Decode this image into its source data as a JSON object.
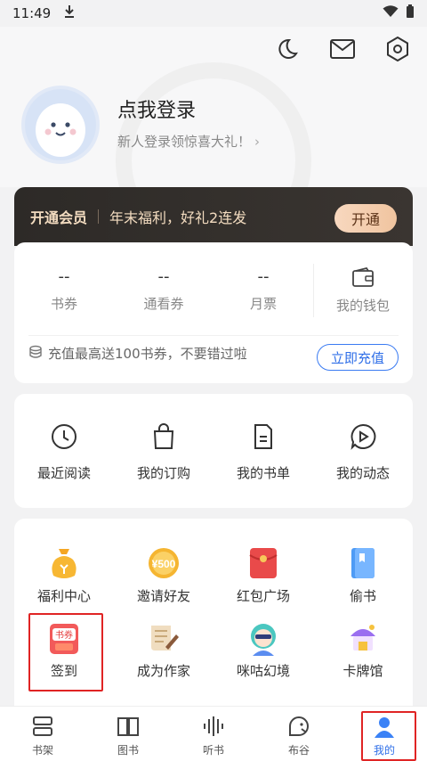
{
  "status_bar": {
    "time": "11:49"
  },
  "header": {
    "login_title": "点我登录",
    "login_subtitle": "新人登录领惊喜大礼！",
    "arrow": "›"
  },
  "vip": {
    "title": "开通会员",
    "promo": "年末福利，好礼2连发",
    "button": "开通"
  },
  "wallet": {
    "items": [
      {
        "value": "--",
        "label": "书券"
      },
      {
        "value": "--",
        "label": "通看券"
      },
      {
        "value": "--",
        "label": "月票"
      }
    ],
    "wallet_label": "我的钱包",
    "recharge_text": "充值最高送100书券，不要错过啦",
    "recharge_button": "立即充值"
  },
  "quick_actions": [
    {
      "label": "最近阅读",
      "icon": "clock-icon"
    },
    {
      "label": "我的订购",
      "icon": "shopping-bag-icon"
    },
    {
      "label": "我的书单",
      "icon": "document-icon"
    },
    {
      "label": "我的动态",
      "icon": "play-chat-icon"
    }
  ],
  "services": {
    "row1": [
      {
        "label": "福利中心",
        "icon": "money-bag-icon"
      },
      {
        "label": "邀请好友",
        "icon": "coin-500-icon",
        "badge": "¥500"
      },
      {
        "label": "红包广场",
        "icon": "red-envelope-icon"
      },
      {
        "label": "偷书",
        "icon": "book-icon"
      }
    ],
    "row2": [
      {
        "label": "签到",
        "icon": "checkin-calendar-icon",
        "badge": "书券"
      },
      {
        "label": "成为作家",
        "icon": "scroll-pen-icon"
      },
      {
        "label": "咪咕幻境",
        "icon": "avatar-character-icon"
      },
      {
        "label": "卡牌馆",
        "icon": "card-hall-icon"
      }
    ]
  },
  "bottom_nav": [
    {
      "label": "书架",
      "icon": "bookshelf-icon"
    },
    {
      "label": "图书",
      "icon": "book-open-icon"
    },
    {
      "label": "听书",
      "icon": "audio-wave-icon"
    },
    {
      "label": "布谷",
      "icon": "cuckoo-icon"
    },
    {
      "label": "我的",
      "icon": "person-icon",
      "active": true
    }
  ],
  "colors": {
    "accent": "#2f6fe8",
    "vip_bg": "#2d2a27",
    "vip_gold": "#f3dcc0",
    "highlight": "#e02424"
  }
}
